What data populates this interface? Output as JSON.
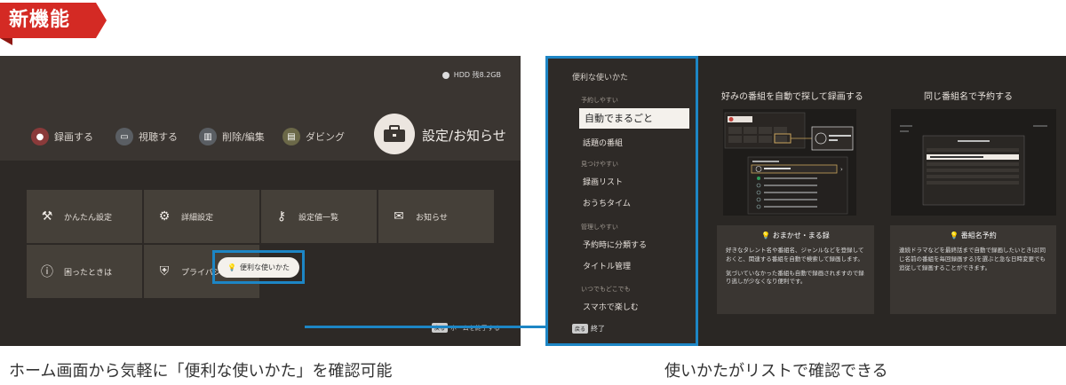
{
  "badge": {
    "label": "新機能"
  },
  "left_screen": {
    "hdd_label": "HDD 残8.2GB",
    "menu": [
      {
        "label": "録画する",
        "icon": "record-icon",
        "color": "#8a3a3a"
      },
      {
        "label": "視聴する",
        "icon": "tv-icon",
        "color": "#5a5e63"
      },
      {
        "label": "削除/編集",
        "icon": "trash-icon",
        "color": "#5a5e63"
      },
      {
        "label": "ダビング",
        "icon": "dubbing-icon",
        "color": "#6b6848"
      }
    ],
    "settings_label": "設定/お知らせ",
    "tiles": [
      {
        "label": "かんたん設定",
        "icon": "tools-icon",
        "glyph": "⚒"
      },
      {
        "label": "詳細設定",
        "icon": "wrench-icon",
        "glyph": "⚙"
      },
      {
        "label": "設定値一覧",
        "icon": "key-icon",
        "glyph": "⚷"
      },
      {
        "label": "お知らせ",
        "icon": "mail-icon",
        "glyph": "✉"
      },
      {
        "label": "困ったときは",
        "icon": "info-icon",
        "glyph": "ⓘ"
      },
      {
        "label": "プライバシー設定",
        "icon": "shield-icon",
        "glyph": "⛨"
      }
    ],
    "tips_button": "便利な使いかた",
    "exit_key": "戻る",
    "exit_label": "ホームを終了する"
  },
  "right_screen": {
    "title": "便利な使いかた",
    "sections": [
      {
        "header": "予約しやすい",
        "items": [
          "自動でまるごと",
          "話題の番組"
        ]
      },
      {
        "header": "見つけやすい",
        "items": [
          "録画リスト",
          "おうちタイム"
        ]
      },
      {
        "header": "管理しやすい",
        "items": [
          "予約時に分類する",
          "タイトル管理"
        ]
      },
      {
        "header": "いつでもどこでも",
        "items": [
          "スマホで楽しむ"
        ]
      }
    ],
    "active_item": "自動でまるごと",
    "exit_key": "戻る",
    "exit_label": "終了",
    "cards": [
      {
        "title": "好みの番組を自動で探して録画する",
        "desc_title": "おまかせ・まる録",
        "desc_text": "好きなタレント名や番組名、ジャンルなどを登録しておくと、関連する番組を自動で検索して録画します。",
        "desc_text2": "気づいていなかった番組も自動で録画されますので録り逃しが少なくなり便利です。"
      },
      {
        "title": "同じ番組名で予約する",
        "desc_title": "番組名予約",
        "desc_text": "連続ドラマなどを最終話まで自動で録画したいときは[同じ名前の番組を毎回録画する]を選ぶと急な日時変更でも追従して録画することができます。",
        "desc_text2": ""
      }
    ]
  },
  "captions": {
    "left": "ホーム画面から気軽に「便利な使いかた」を確認可能",
    "right": "使いかたがリストで確認できる"
  }
}
